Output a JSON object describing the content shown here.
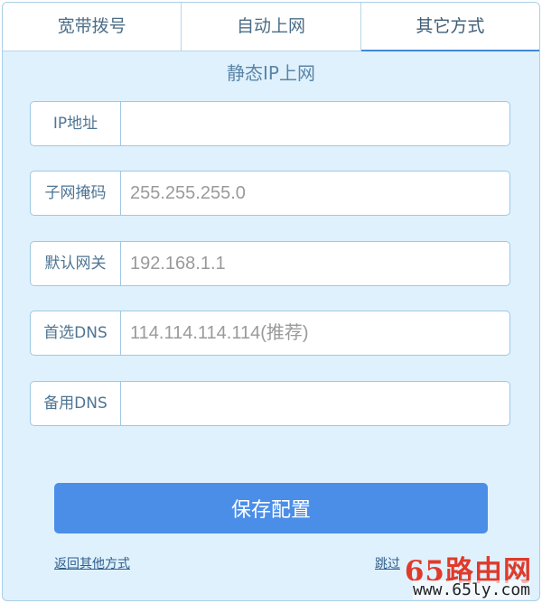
{
  "tabs": [
    {
      "label": "宽带拨号"
    },
    {
      "label": "自动上网"
    },
    {
      "label": "其它方式"
    }
  ],
  "section_title": "静态IP上网",
  "fields": [
    {
      "label": "IP地址",
      "placeholder": ""
    },
    {
      "label": "子网掩码",
      "placeholder": "255.255.255.0"
    },
    {
      "label": "默认网关",
      "placeholder": "192.168.1.1"
    },
    {
      "label": "首选DNS",
      "placeholder": "114.114.114.114(推荐)"
    },
    {
      "label": "备用DNS",
      "placeholder": ""
    }
  ],
  "save_label": "保存配置",
  "links": {
    "back": "返回其他方式",
    "skip": "跳过"
  },
  "watermark": {
    "main": "65路由网",
    "sub": "www.65ly.com"
  }
}
